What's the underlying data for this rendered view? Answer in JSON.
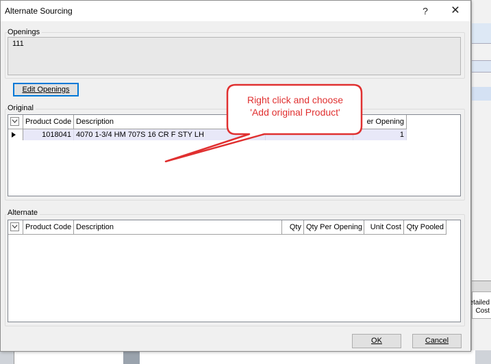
{
  "dialog": {
    "title": "Alternate Sourcing",
    "help_glyph": "?",
    "close_glyph": "✕"
  },
  "openings": {
    "label": "Openings",
    "value": "111",
    "edit_button": "Edit Openings"
  },
  "original": {
    "label": "Original",
    "columns": [
      "Product Code",
      "Description",
      "er Opening"
    ],
    "rows": [
      {
        "product_code": "1018041",
        "description": "4070 1-3/4 HM 707S 16 CR F STY LH",
        "qty_per_opening": "1"
      }
    ]
  },
  "alternate": {
    "label": "Alternate",
    "columns": [
      "Product Code",
      "Description",
      "Qty",
      "Qty Per Opening",
      "Unit Cost",
      "Qty Pooled"
    ]
  },
  "callout": {
    "line1": "Right click and choose",
    "line2": "'Add original Product'",
    "color": "#e03030"
  },
  "footer": {
    "ok_label": "OK",
    "cancel_label": "Cancel"
  },
  "background_app": {
    "partial_text_1": "etailed",
    "partial_text_2": "Cost"
  }
}
